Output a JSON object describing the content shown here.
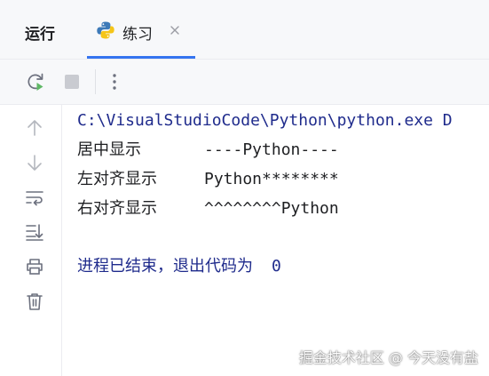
{
  "header": {
    "run_title": "运行",
    "tab_label": "练习"
  },
  "icons": {
    "tab": [
      "python-icon",
      "close-icon"
    ],
    "toolbar": [
      "rerun-icon",
      "stop-icon",
      "more-options-icon"
    ],
    "gutter": [
      "up-arrow-icon",
      "down-arrow-icon",
      "soft-wrap-icon",
      "scroll-to-end-icon",
      "print-icon",
      "trash-icon"
    ]
  },
  "colors": {
    "accent": "#3574f0",
    "console_text": "#1e1f22",
    "system_text": "#1f2b8c"
  },
  "console": {
    "command": "C:\\VisualStudioCode\\Python\\python.exe D",
    "rows": [
      {
        "label": "居中显示",
        "value": "----Python----"
      },
      {
        "label": "左对齐显示",
        "value": "Python********"
      },
      {
        "label": "右对齐显示",
        "value": "^^^^^^^^Python"
      }
    ],
    "exit_text": "进程已结束，退出代码为",
    "exit_code": "0"
  },
  "watermark": "掘金技术社区 @ 今天没有盐"
}
